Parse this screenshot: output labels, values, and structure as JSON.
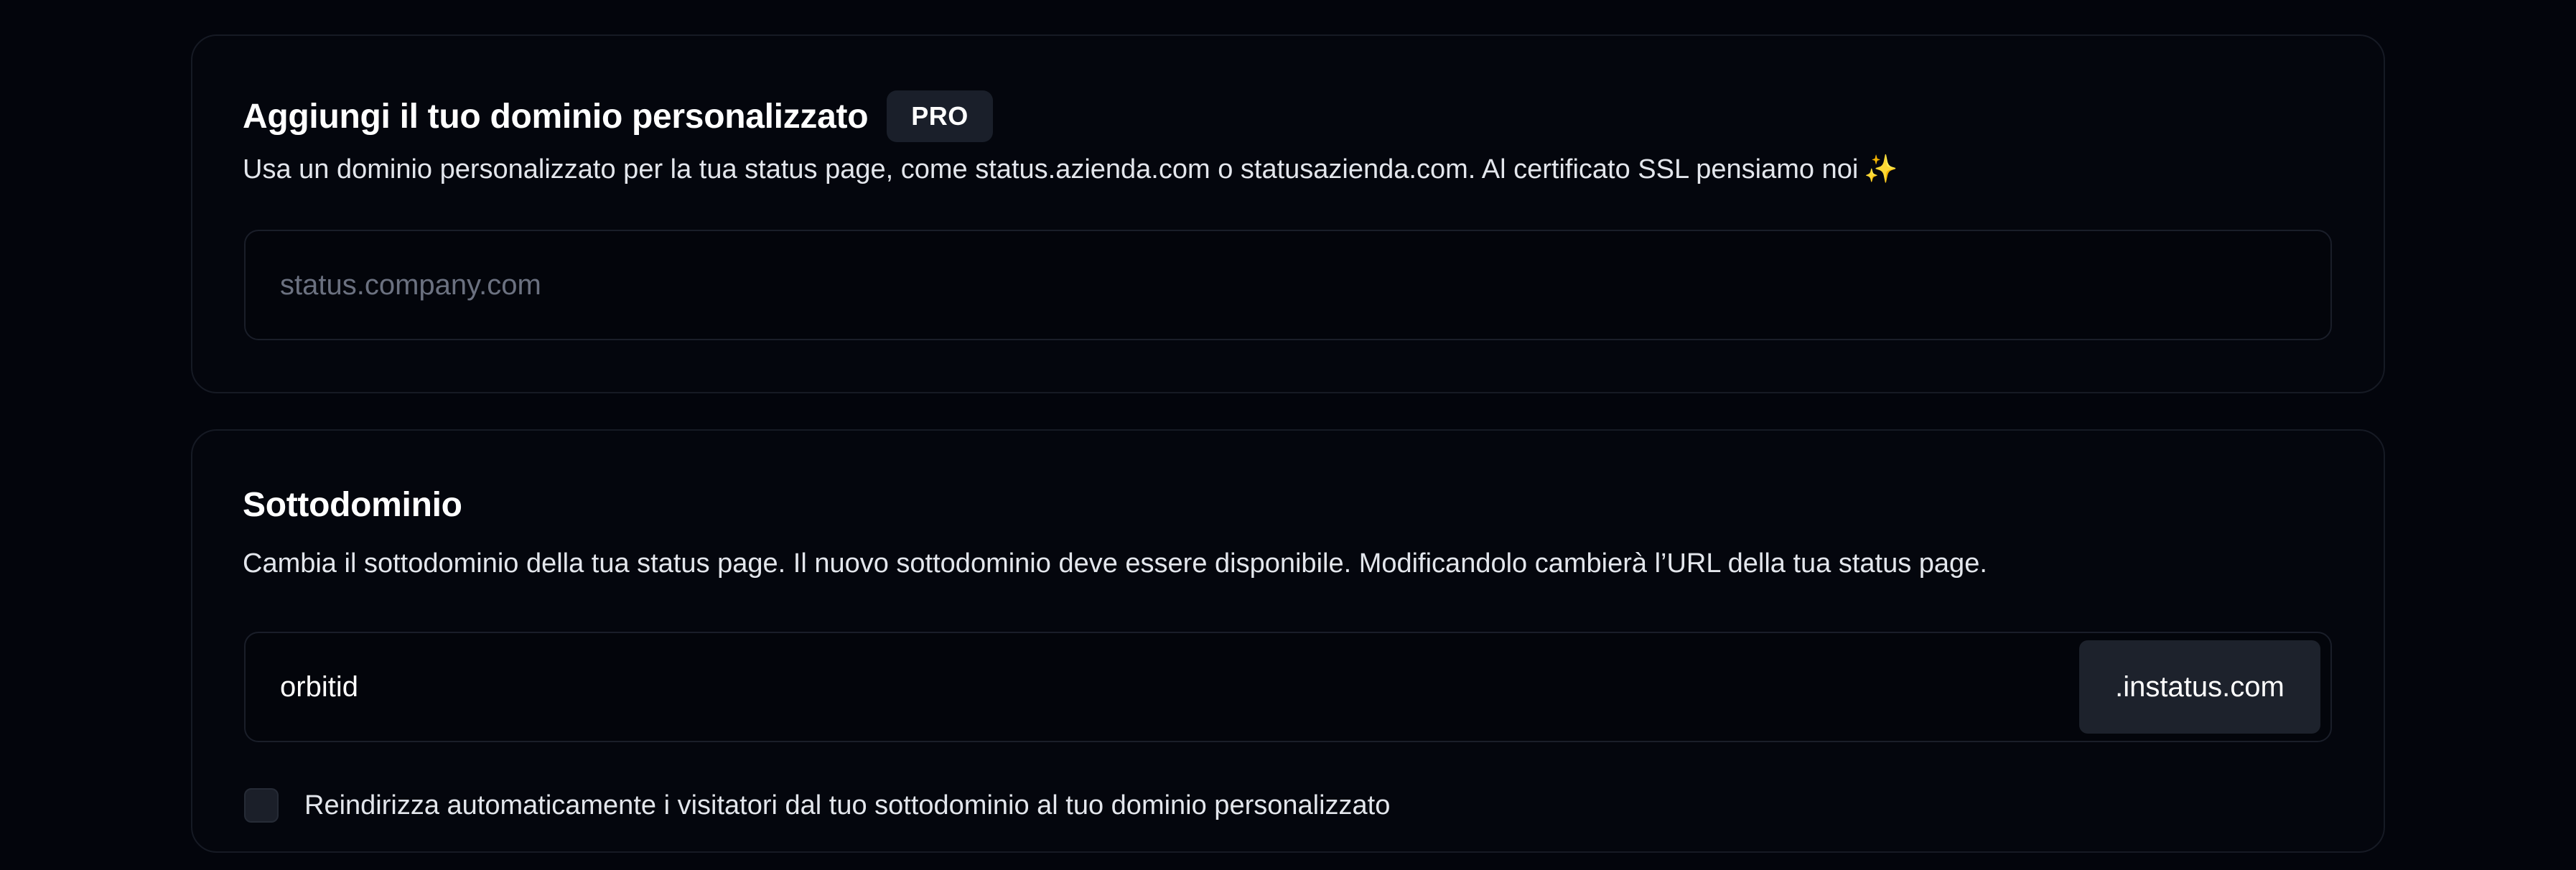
{
  "custom_domain": {
    "title": "Aggiungi il tuo dominio personalizzato",
    "badge": "PRO",
    "description": "Usa un dominio personalizzato per la tua status page, come status.azienda.com o statusazienda.com. Al certificato SSL pensiamo noi",
    "description_emoji": "✨",
    "input_placeholder": "status.company.com",
    "input_value": ""
  },
  "subdomain": {
    "title": "Sottodominio",
    "description": "Cambia il sottodominio della tua status page. Il nuovo sottodominio deve essere disponibile. Modificandolo cambierà l’URL della tua status page.",
    "input_value": "orbitid",
    "suffix": ".instatus.com",
    "available_icon": "check-circle-icon",
    "redirect_checkbox_label": "Reindirizza automaticamente i visitatori dal tuo sottodominio al tuo dominio personalizzato",
    "redirect_checked": false
  },
  "colors": {
    "background": "#03050c",
    "accent_success": "#1fd6b4",
    "card_border": "#161a24"
  }
}
